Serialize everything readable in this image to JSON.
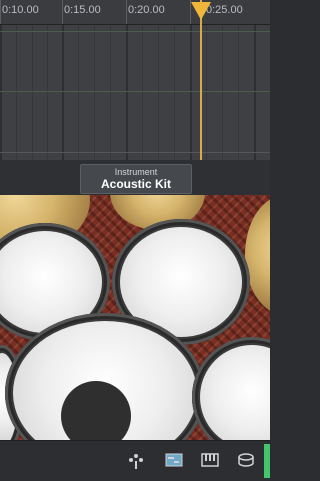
{
  "timeline": {
    "ticks": [
      "0:10.00",
      "0:15.00",
      "0:20.00",
      "0:25.00"
    ]
  },
  "instrument": {
    "caption": "Instrument",
    "name": "Acoustic Kit"
  },
  "icons": {
    "bottom": [
      "smart-controls-icon",
      "editors-icon",
      "keyboard-icon",
      "drum-icon"
    ]
  },
  "colors": {
    "playhead": "#f0b63a",
    "accent_green": "#45c46b"
  }
}
